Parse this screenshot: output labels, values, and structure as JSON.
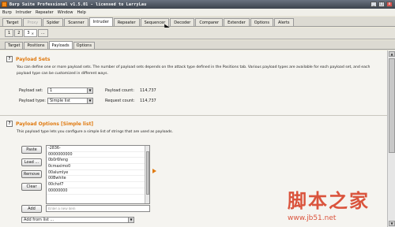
{
  "window": {
    "title": "Burp Suite Professional v1.5.01 - licensed to LarryLau",
    "minimize": "_",
    "maximize": "□",
    "close": "x"
  },
  "menu": [
    "Burp",
    "Intruder",
    "Repeater",
    "Window",
    "Help"
  ],
  "main_tabs": [
    {
      "label": "Target"
    },
    {
      "label": "Proxy"
    },
    {
      "label": "Spider"
    },
    {
      "label": "Scanner"
    },
    {
      "label": "Intruder"
    },
    {
      "label": "Repeater"
    },
    {
      "label": "Sequencer"
    },
    {
      "label": "Decoder"
    },
    {
      "label": "Comparer"
    },
    {
      "label": "Extender"
    },
    {
      "label": "Options"
    },
    {
      "label": "Alerts"
    }
  ],
  "number_tabs": [
    "1",
    "2",
    "3",
    "..."
  ],
  "number_tab_close": "×",
  "sub_tabs": [
    "Target",
    "Positions",
    "Payloads",
    "Options"
  ],
  "payload_sets": {
    "help": "?",
    "title": "Payload Sets",
    "description": "You can define one or more payload sets. The number of payload sets depends on the attack type defined in the Positions tab. Various payload types are available for each payload set, and each payload type can be customized in different ways.",
    "set_label": "Payload set:",
    "set_value": "1",
    "type_label": "Payload type:",
    "type_value": "Simple list",
    "payload_count_label": "Payload count:",
    "payload_count_value": "114,737",
    "request_count_label": "Request count:",
    "request_count_value": "114,737"
  },
  "payload_options": {
    "help": "?",
    "title": "Payload Options [Simple list]",
    "description": "This payload type lets you configure a simple list of strings that are used as payloads.",
    "buttons": {
      "paste": "Paste",
      "load": "Load ...",
      "remove": "Remove",
      "clear": "Clear",
      "add": "Add"
    },
    "list_items": [
      "-2836-",
      "0000000000",
      "0b0r6feng",
      "0cmaximo0",
      "00alumlye",
      "00Bwhite",
      "00chof7",
      "00000000"
    ],
    "add_placeholder": "Enter a new item",
    "add_from_list": "Add from list ..."
  },
  "watermark": {
    "text": "脚本之家",
    "url": "www.jb51.net"
  }
}
